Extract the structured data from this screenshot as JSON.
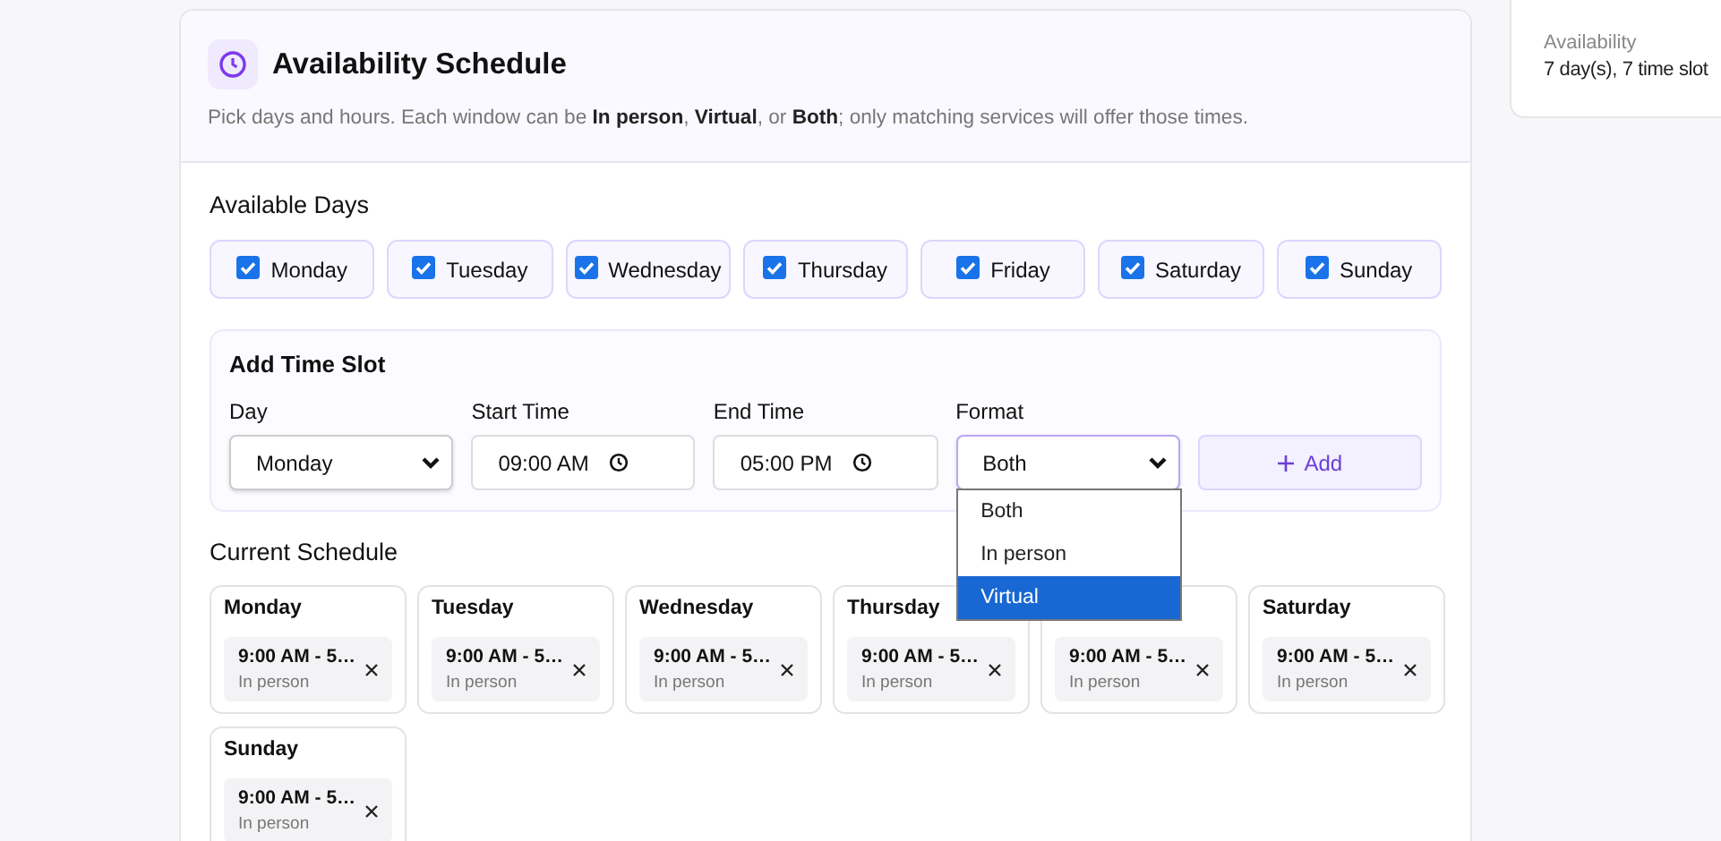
{
  "header": {
    "title": "Availability Schedule",
    "subtitle": "Pick days and hours. Each window can be **In person**, **Virtual**, or **Both**; only matching services will offer those times."
  },
  "available_days": {
    "label": "Available Days",
    "days": [
      {
        "label": "Monday",
        "checked": true
      },
      {
        "label": "Tuesday",
        "checked": true
      },
      {
        "label": "Wednesday",
        "checked": true
      },
      {
        "label": "Thursday",
        "checked": true
      },
      {
        "label": "Friday",
        "checked": true
      },
      {
        "label": "Saturday",
        "checked": true
      },
      {
        "label": "Sunday",
        "checked": true
      }
    ]
  },
  "add_time_slot": {
    "title": "Add Time Slot",
    "fields": [
      {
        "kind": "select",
        "label": "Day",
        "value": "Monday"
      },
      {
        "kind": "time",
        "label": "Start Time",
        "value": "09:00 AM"
      },
      {
        "kind": "time",
        "label": "End Time",
        "value": "05:00 PM"
      },
      {
        "kind": "select",
        "label": "Format",
        "value": "Both",
        "expanded": true,
        "options": [
          {
            "label": "Both",
            "highlighted": false
          },
          {
            "label": "In person",
            "highlighted": false
          },
          {
            "label": "Virtual",
            "highlighted": true
          }
        ]
      }
    ],
    "add_button": "Add"
  },
  "current_schedule": {
    "label": "Current Schedule",
    "days": [
      {
        "day": "Monday",
        "slots": [
          {
            "time": "9:00 AM - 5…",
            "format": "In person"
          }
        ]
      },
      {
        "day": "Tuesday",
        "slots": [
          {
            "time": "9:00 AM - 5…",
            "format": "In person"
          }
        ]
      },
      {
        "day": "Wednesday",
        "slots": [
          {
            "time": "9:00 AM - 5…",
            "format": "In person"
          }
        ]
      },
      {
        "day": "Thursday",
        "slots": [
          {
            "time": "9:00 AM - 5…",
            "format": "In person"
          }
        ]
      },
      {
        "slots": [
          {
            "time": "9:00 AM - 5…",
            "format": "In person"
          }
        ]
      },
      {
        "day": "Saturday",
        "slots": [
          {
            "time": "9:00 AM - 5…",
            "format": "In person"
          }
        ]
      },
      {
        "day": "Sunday",
        "slots": [
          {
            "time": "9:00 AM - 5…",
            "format": "In person"
          }
        ]
      }
    ]
  },
  "summary": {
    "label": "Availability",
    "value": "7 day(s), 7 time slot"
  }
}
